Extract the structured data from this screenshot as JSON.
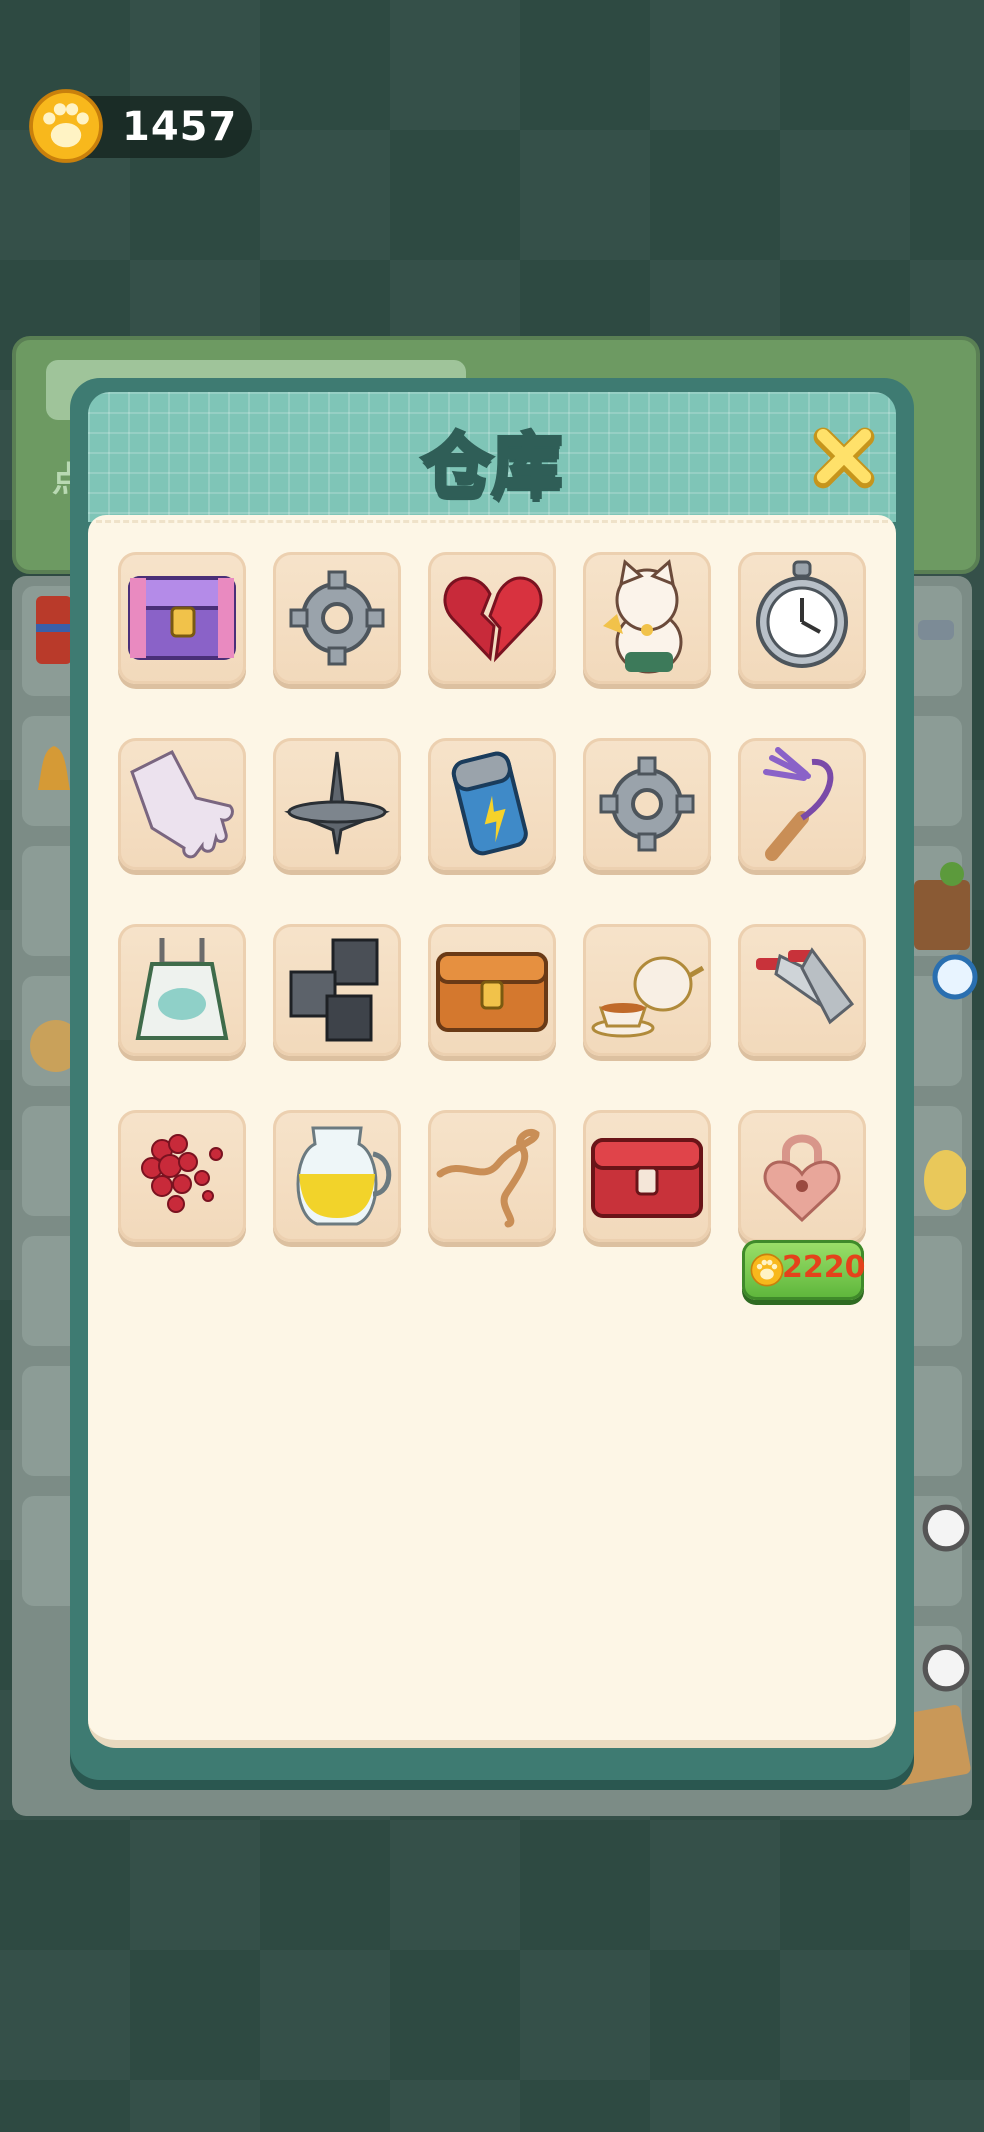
{
  "currency": {
    "amount": "1457",
    "icon": "paw-coin-icon"
  },
  "background": {
    "board_char": "点"
  },
  "modal": {
    "title": "仓库",
    "close_icon": "close-icon",
    "slots": [
      {
        "icon": "purple-chest-icon"
      },
      {
        "icon": "gear-icon"
      },
      {
        "icon": "broken-heart-icon"
      },
      {
        "icon": "lucky-cat-icon"
      },
      {
        "icon": "pocket-watch-icon"
      },
      {
        "icon": "rubber-glove-icon"
      },
      {
        "icon": "spinning-top-icon"
      },
      {
        "icon": "battery-icon"
      },
      {
        "icon": "gear-icon"
      },
      {
        "icon": "whip-icon"
      },
      {
        "icon": "cat-apron-icon"
      },
      {
        "icon": "metal-cubes-icon"
      },
      {
        "icon": "wooden-chest-icon"
      },
      {
        "icon": "tea-set-icon"
      },
      {
        "icon": "cleaver-knives-icon"
      },
      {
        "icon": "red-petals-icon"
      },
      {
        "icon": "oil-jug-icon"
      },
      {
        "icon": "rope-icon"
      },
      {
        "icon": "red-chest-icon"
      },
      {
        "icon": "locked-slot-icon"
      }
    ],
    "unlock": {
      "price": "2220",
      "icon": "paw-coin-icon"
    }
  },
  "colors": {
    "background": "#2e4a42",
    "modal_frame": "#3e7b72",
    "modal_header": "#7fc5b7",
    "modal_body": "#fdf6e6",
    "slot": "#f4dec2",
    "price_button": "#6fc447",
    "price_text": "#e4421b"
  }
}
